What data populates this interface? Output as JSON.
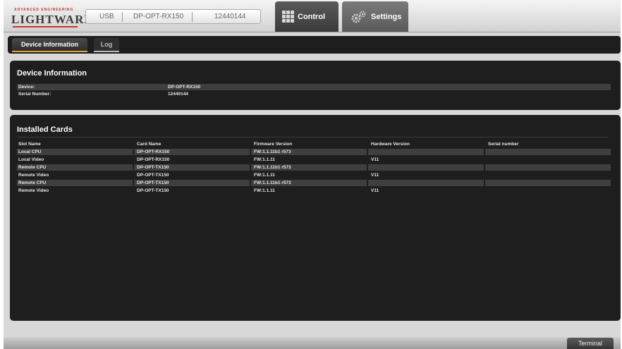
{
  "header": {
    "logo": {
      "tagline": "ADVANCED ENGINEERING",
      "wordmark": "LIGHTWARE"
    },
    "connection": {
      "interface": "USB",
      "device": "DP-OPT-RX150",
      "serial": "12440144"
    },
    "nav": {
      "control_label": "Control",
      "settings_label": "Settings"
    }
  },
  "tabs": [
    {
      "label": "Device Information",
      "active": true
    },
    {
      "label": "Log",
      "active": false
    }
  ],
  "device_info": {
    "title": "Device Information",
    "fields": [
      {
        "label": "Device:",
        "value": "DP-OPT-RX150"
      },
      {
        "label": "Serial Number:",
        "value": "12440144"
      }
    ]
  },
  "installed_cards": {
    "title": "Installed Cards",
    "columns": [
      "Slot Name",
      "Card Name",
      "Firmware Version",
      "Hardware Version",
      "Serial number"
    ],
    "rows": [
      [
        "Local CPU",
        "DP-OPT-RX150",
        "FW:1.1.11b1 r573",
        "",
        ""
      ],
      [
        "Local Video",
        "DP-OPT-RX150",
        "FW:1.1.11",
        "V11",
        ""
      ],
      [
        "Remote CPU",
        "DP-OPT-TX150",
        "FW:1.1.11b1 r573",
        "",
        ""
      ],
      [
        "Remote Video",
        "DP-OPT-TX150",
        "FW:1.1.11",
        "V11",
        ""
      ],
      [
        "Remote CPU",
        "DP-OPT-TX150",
        "FW:1.1.11b1 r573",
        "",
        ""
      ],
      [
        "Remote Video",
        "DP-OPT-TX150",
        "FW:1.1.11",
        "V11",
        ""
      ]
    ]
  },
  "footer": {
    "terminal_label": "Terminal"
  },
  "colors": {
    "accent": "#e0a43a",
    "brand_red": "#c0392b",
    "panel_bg": "#1e1e1e",
    "row_stripe": "#3f3f3f"
  },
  "icons": {
    "control": "grid-icon",
    "settings": "gears-icon"
  }
}
